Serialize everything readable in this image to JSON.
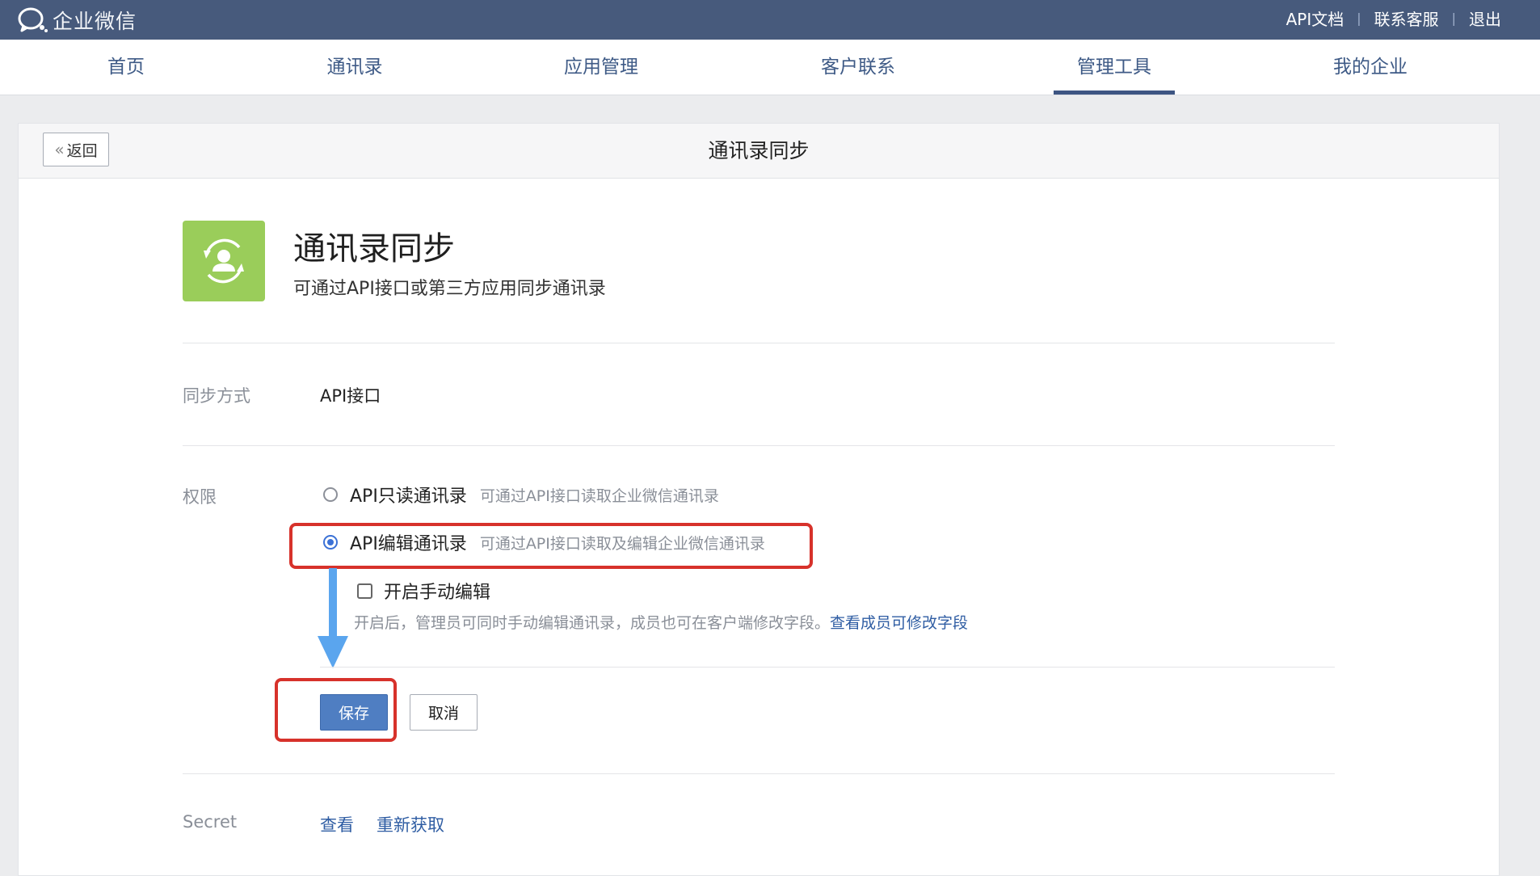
{
  "topbar": {
    "logo_text": "企业微信",
    "links": [
      "API文档",
      "联系客服",
      "退出"
    ]
  },
  "nav": {
    "items": [
      "首页",
      "通讯录",
      "应用管理",
      "客户联系",
      "管理工具",
      "我的企业"
    ],
    "active": "管理工具"
  },
  "panel": {
    "back_label": "返回",
    "title": "通讯录同步"
  },
  "app": {
    "name": "通讯录同步",
    "description": "可通过API接口或第三方应用同步通讯录",
    "icon": "user-sync-icon",
    "icon_color": "#9acd5a"
  },
  "sync": {
    "label": "同步方式",
    "value": "API接口"
  },
  "permission": {
    "label": "权限",
    "options": [
      {
        "label": "API只读通讯录",
        "hint": "可通过API接口读取企业微信通讯录",
        "checked": false
      },
      {
        "label": "API编辑通讯录",
        "hint": "可通过API接口读取及编辑企业微信通讯录",
        "checked": true
      }
    ],
    "manual_edit": {
      "label": "开启手动编辑",
      "checked": false,
      "hint": "开启后，管理员可同时手动编辑通讯录，成员也可在客户端修改字段。",
      "hint_link": "查看成员可修改字段"
    }
  },
  "actions": {
    "save_label": "保存",
    "cancel_label": "取消"
  },
  "secret": {
    "label": "Secret",
    "view_label": "查看",
    "refresh_label": "重新获取"
  },
  "colors": {
    "topbar": "#475a7c",
    "accent": "#3b71d6",
    "primary_button": "#4f7ec2",
    "annotation_red": "#d7322b",
    "annotation_arrow": "#5aa5ee"
  }
}
